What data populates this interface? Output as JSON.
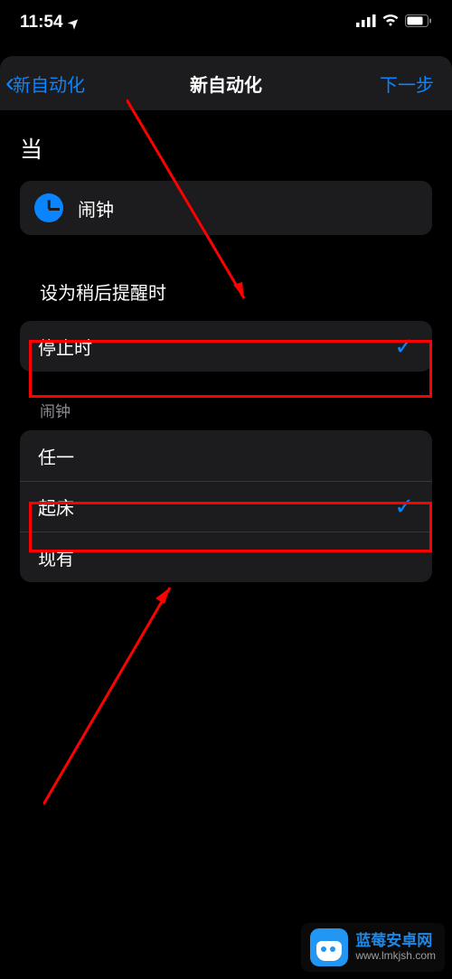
{
  "status": {
    "time": "11:54",
    "location_glyph": "➤"
  },
  "nav": {
    "back": "新自动化",
    "title": "新自动化",
    "next": "下一步"
  },
  "heading": "当",
  "trigger": {
    "label": "闹钟"
  },
  "group1": {
    "title": "设为稍后提醒时",
    "rows": [
      {
        "label": "停止时",
        "selected": true
      }
    ]
  },
  "group2": {
    "title": "闹钟",
    "rows": [
      {
        "label": "任一",
        "selected": false
      },
      {
        "label": "起床",
        "selected": true
      },
      {
        "label": "现有",
        "selected": false
      }
    ]
  },
  "watermark": {
    "name": "蓝莓安卓网",
    "url": "www.lmkjsh.com"
  }
}
